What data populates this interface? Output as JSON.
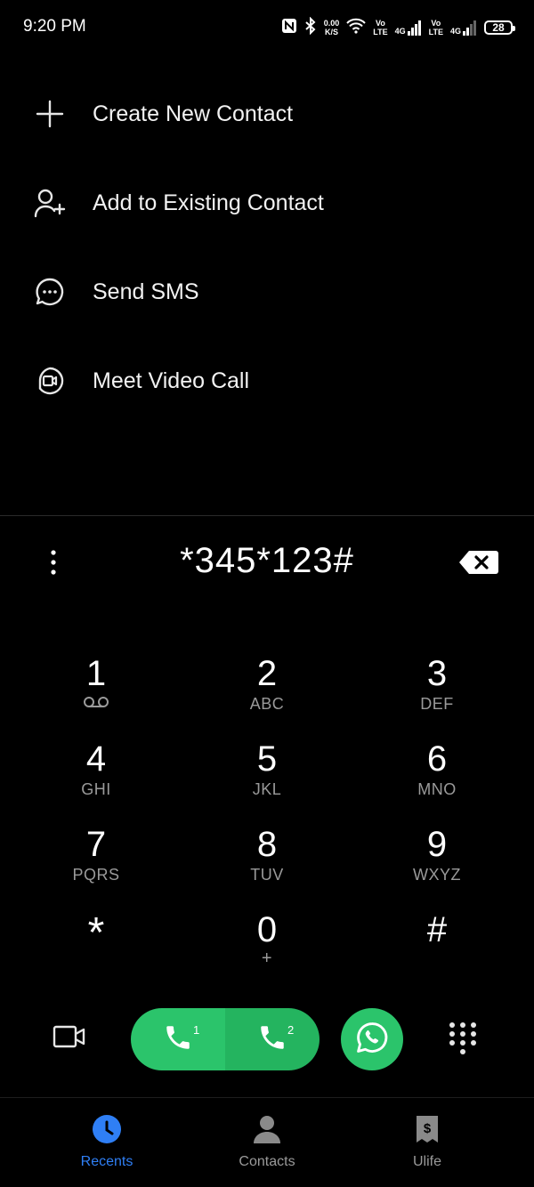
{
  "status_bar": {
    "time": "9:20 PM",
    "net_speed_value": "0.00",
    "net_speed_unit": "K/S",
    "volte1_top": "Vo",
    "volte1_bottom": "LTE",
    "net1": "4G",
    "volte2_top": "Vo",
    "volte2_bottom": "LTE",
    "net2": "4G",
    "battery": "28",
    "icons": [
      "nfc-icon",
      "bluetooth-icon",
      "wifi-icon",
      "signal-icon",
      "battery-icon"
    ]
  },
  "menu": {
    "items": [
      {
        "label": "Create New Contact",
        "icon": "plus-icon"
      },
      {
        "label": "Add to Existing Contact",
        "icon": "add-person-icon"
      },
      {
        "label": "Send SMS",
        "icon": "message-icon"
      },
      {
        "label": "Meet Video Call",
        "icon": "meet-video-icon"
      }
    ]
  },
  "dialer": {
    "number": "*345*123#"
  },
  "keypad": {
    "keys": [
      {
        "digit": "1",
        "letters": ""
      },
      {
        "digit": "2",
        "letters": "ABC"
      },
      {
        "digit": "3",
        "letters": "DEF"
      },
      {
        "digit": "4",
        "letters": "GHI"
      },
      {
        "digit": "5",
        "letters": "JKL"
      },
      {
        "digit": "6",
        "letters": "MNO"
      },
      {
        "digit": "7",
        "letters": "PQRS"
      },
      {
        "digit": "8",
        "letters": "TUV"
      },
      {
        "digit": "9",
        "letters": "WXYZ"
      },
      {
        "digit": "*",
        "letters": ""
      },
      {
        "digit": "0",
        "letters": "+"
      },
      {
        "digit": "#",
        "letters": ""
      }
    ]
  },
  "actions": {
    "sim1_label": "1",
    "sim2_label": "2"
  },
  "bottom_nav": {
    "items": [
      {
        "label": "Recents",
        "active": true
      },
      {
        "label": "Contacts",
        "active": false
      },
      {
        "label": "Ulife",
        "active": false
      }
    ]
  },
  "colors": {
    "accent": "#2f7ff5",
    "call_green": "#2bc46b",
    "background": "#000000"
  }
}
